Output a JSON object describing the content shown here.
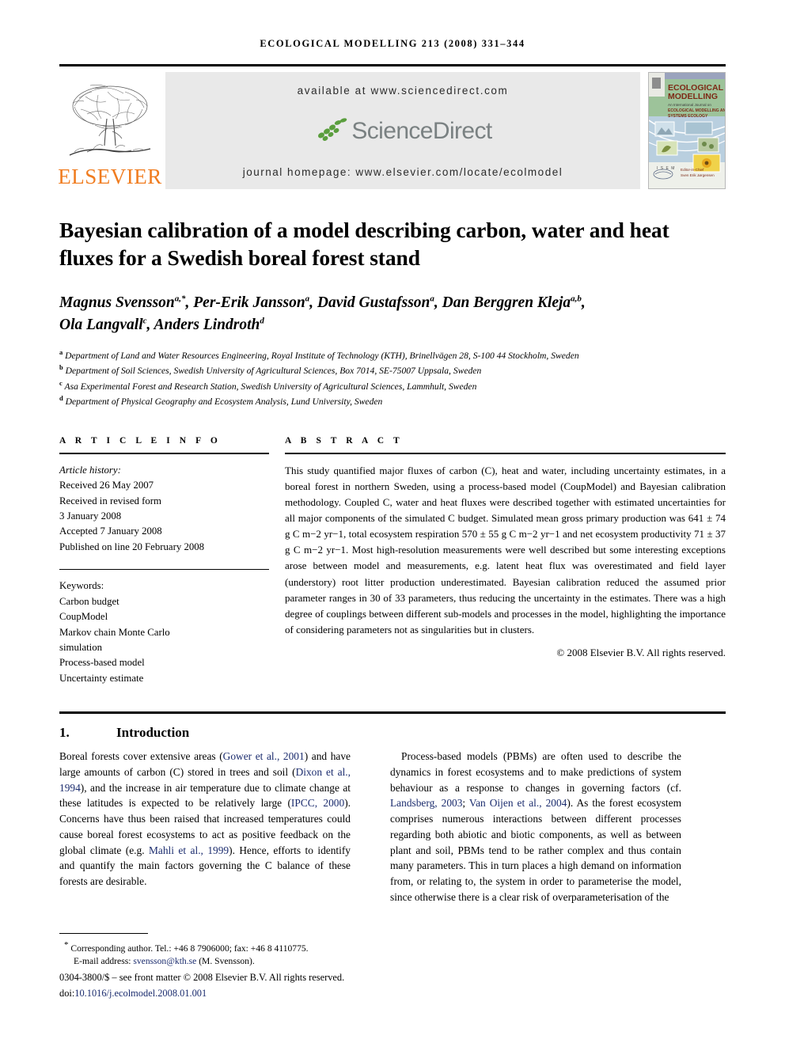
{
  "running_head": "ECOLOGICAL MODELLING 213 (2008) 331–344",
  "masthead": {
    "publisher": "ELSEVIER",
    "available_at": "available at www.sciencedirect.com",
    "sciencedirect_wordmark": "ScienceDirect",
    "journal_homepage": "journal homepage: www.elsevier.com/locate/ecolmodel",
    "cover": {
      "journal_title_line1": "ECOLOGICAL",
      "journal_title_line2": "MODELLING",
      "subtitle": "An International Journal on",
      "scope_line1": "ECOLOGICAL MODELLING AND",
      "scope_line2": "SYSTEMS ECOLOGY",
      "editor_label": "Editor-in-Chief",
      "editor_name": "Sven Erik Jørgensen",
      "badge": "ISEM"
    },
    "colors": {
      "elsevier_orange": "#F07C1F",
      "sciencedirect_grey": "#7a8182",
      "sciencedirect_green": "#5a9e3d",
      "banner_bg": "#e9e9e9",
      "cover_green": "#9fc49b"
    }
  },
  "article": {
    "title": "Bayesian calibration of a model describing carbon, water and heat fluxes for a Swedish boreal forest stand",
    "authors_line1_parts": [
      {
        "name": "Magnus Svensson",
        "sup": "a,*"
      },
      {
        "name": "Per-Erik Jansson",
        "sup": "a"
      },
      {
        "name": "David Gustafsson",
        "sup": "a"
      },
      {
        "name": "Dan Berggren Kleja",
        "sup": "a,b"
      }
    ],
    "authors_line2_parts": [
      {
        "name": "Ola Langvall",
        "sup": "c"
      },
      {
        "name": "Anders Lindroth",
        "sup": "d"
      }
    ],
    "affiliations": [
      {
        "marker": "a",
        "text": "Department of Land and Water Resources Engineering, Royal Institute of Technology (KTH), Brinellvägen 28, S-100 44 Stockholm, Sweden"
      },
      {
        "marker": "b",
        "text": "Department of Soil Sciences, Swedish University of Agricultural Sciences, Box 7014, SE-75007 Uppsala, Sweden"
      },
      {
        "marker": "c",
        "text": "Asa Experimental Forest and Research Station, Swedish University of Agricultural Sciences, Lammhult, Sweden"
      },
      {
        "marker": "d",
        "text": "Department of Physical Geography and Ecosystem Analysis, Lund University, Sweden"
      }
    ]
  },
  "article_info": {
    "heading": "A R T I C L E   I N F O",
    "history_label": "Article history:",
    "history": [
      "Received 26 May 2007",
      "Received in revised form",
      "3 January 2008",
      "Accepted 7 January 2008",
      "Published on line 20 February 2008"
    ],
    "keywords_label": "Keywords:",
    "keywords": [
      "Carbon budget",
      "CoupModel",
      "Markov chain Monte Carlo",
      "simulation",
      "Process-based model",
      "Uncertainty estimate"
    ]
  },
  "abstract": {
    "heading": "A B S T R A C T",
    "text": "This study quantified major fluxes of carbon (C), heat and water, including uncertainty estimates, in a boreal forest in northern Sweden, using a process-based model (CoupModel) and Bayesian calibration methodology. Coupled C, water and heat fluxes were described together with estimated uncertainties for all major components of the simulated C budget. Simulated mean gross primary production was 641 ± 74 g C m−2 yr−1, total ecosystem respiration 570 ± 55 g C m−2 yr−1 and net ecosystem productivity 71 ± 37 g C m−2 yr−1. Most high-resolution measurements were well described but some interesting exceptions arose between model and measurements, e.g. latent heat flux was overestimated and field layer (understory) root litter production underestimated. Bayesian calibration reduced the assumed prior parameter ranges in 30 of 33 parameters, thus reducing the uncertainty in the estimates. There was a high degree of couplings between different sub-models and processes in the model, highlighting the importance of considering parameters not as singularities but in clusters.",
    "copyright": "© 2008 Elsevier B.V. All rights reserved."
  },
  "introduction": {
    "number": "1.",
    "heading": "Introduction",
    "left_paragraph": "Boreal forests cover extensive areas (Gower et al., 2001) and have large amounts of carbon (C) stored in trees and soil (Dixon et al., 1994), and the increase in air temperature due to climate change at these latitudes is expected to be relatively large (IPCC, 2000). Concerns have thus been raised that increased temperatures could cause boreal forest ecosystems to act as positive feedback on the global climate (e.g. Mahli et al., 1999). Hence, efforts to identify and quantify the main factors governing the C balance of these forests are desirable.",
    "right_paragraph": "Process-based models (PBMs) are often used to describe the dynamics in forest ecosystems and to make predictions of system behaviour as a response to changes in governing factors (cf. Landsberg, 2003; Van Oijen et al., 2004). As the forest ecosystem comprises numerous interactions between different processes regarding both abiotic and biotic components, as well as between plant and soil, PBMs tend to be rather complex and thus contain many parameters. This in turn places a high demand on information from, or relating to, the system in order to parameterise the model, since otherwise there is a clear risk of overparameterisation of the",
    "citations": [
      "Gower et al., 2001",
      "Dixon et al., 1994",
      "IPCC, 2000",
      "Mahli et al., 1999",
      "Landsberg, 2003",
      "Van Oijen et al., 2004"
    ]
  },
  "footer": {
    "corresponding_marker": "*",
    "corresponding_label": "Corresponding author.",
    "corresponding_contact": "Tel.: +46 8 7906000; fax: +46 8 4110775.",
    "email_label": "E-mail address:",
    "email": "svensson@kth.se",
    "email_owner": "(M. Svensson).",
    "imprint": "0304-3800/$ – see front matter © 2008 Elsevier B.V. All rights reserved.",
    "doi_label": "doi:",
    "doi": "10.1016/j.ecolmodel.2008.01.001"
  }
}
